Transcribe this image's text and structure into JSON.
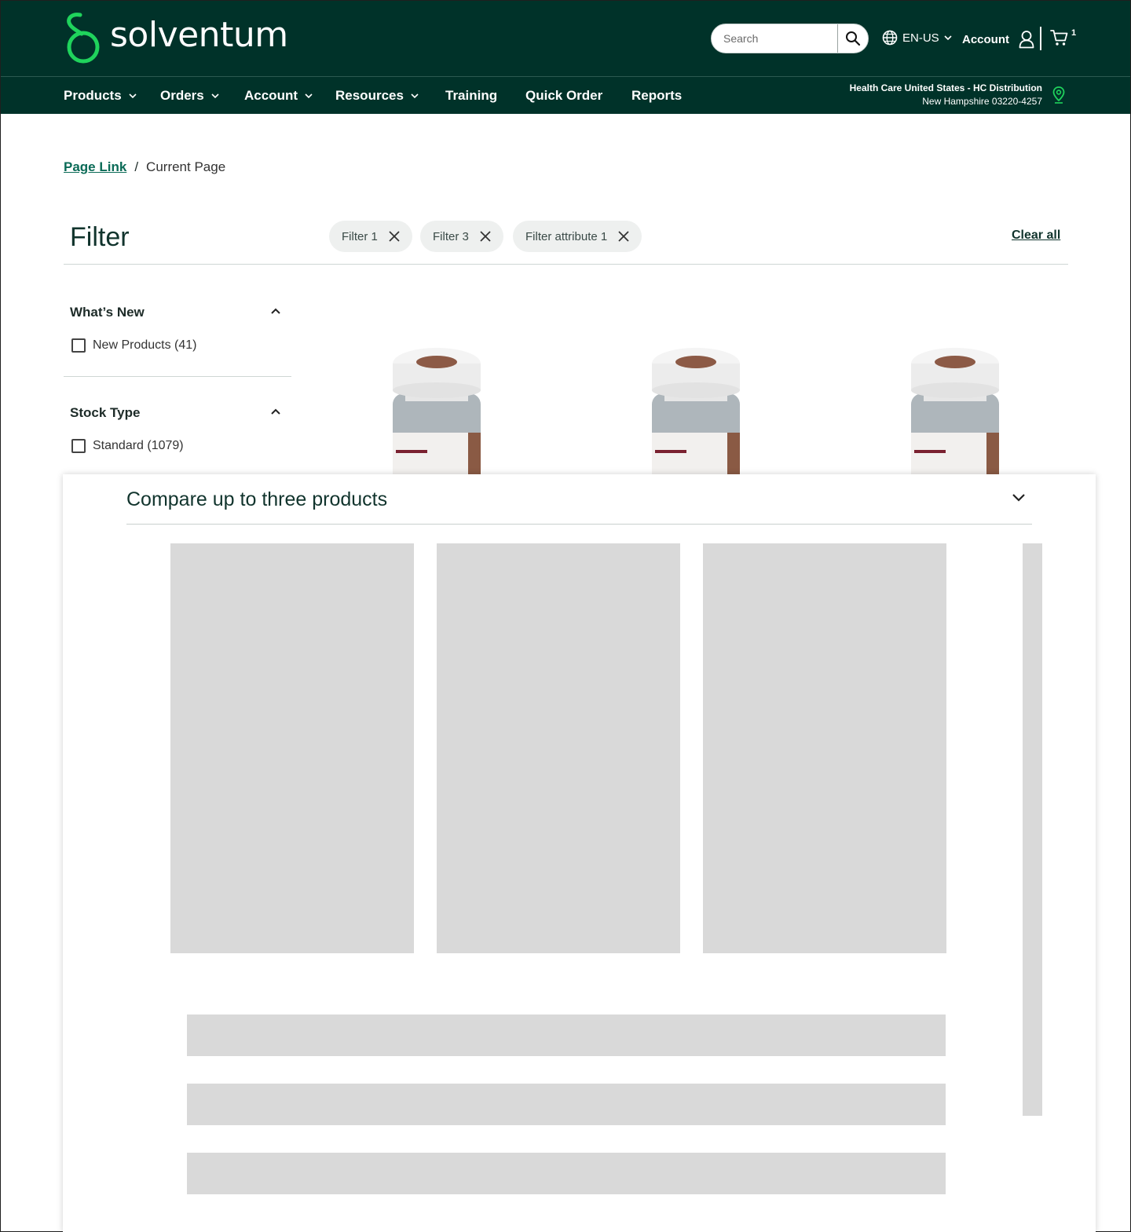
{
  "header": {
    "brand": "solventum",
    "search_placeholder": "Search",
    "language": "EN-US",
    "account_label": "Account",
    "cart_count": "1",
    "brand_color": "#003229",
    "accent_color": "#1fd35c"
  },
  "nav": {
    "items": [
      {
        "label": "Products",
        "dropdown": true
      },
      {
        "label": "Orders",
        "dropdown": true
      },
      {
        "label": "Account",
        "dropdown": true
      },
      {
        "label": "Resources",
        "dropdown": true
      },
      {
        "label": "Training",
        "dropdown": false
      },
      {
        "label": "Quick Order",
        "dropdown": false
      },
      {
        "label": "Reports",
        "dropdown": false
      }
    ],
    "location_line1": "Health Care United States - HC Distribution",
    "location_line2": "New Hampshire 03220-4257"
  },
  "breadcrumb": {
    "link": "Page Link",
    "separator": "/",
    "current": "Current Page"
  },
  "filter": {
    "title": "Filter",
    "chips": [
      "Filter 1",
      "Filter 3",
      "Filter attribute 1"
    ],
    "clear_all": "Clear all"
  },
  "facets": [
    {
      "heading": "What’s New",
      "options": [
        {
          "label": "New Products (41)",
          "checked": false
        }
      ]
    },
    {
      "heading": "Stock Type",
      "options": [
        {
          "label": "Standard (1079)",
          "checked": false
        }
      ]
    }
  ],
  "compare": {
    "title": "Compare up to three products"
  }
}
